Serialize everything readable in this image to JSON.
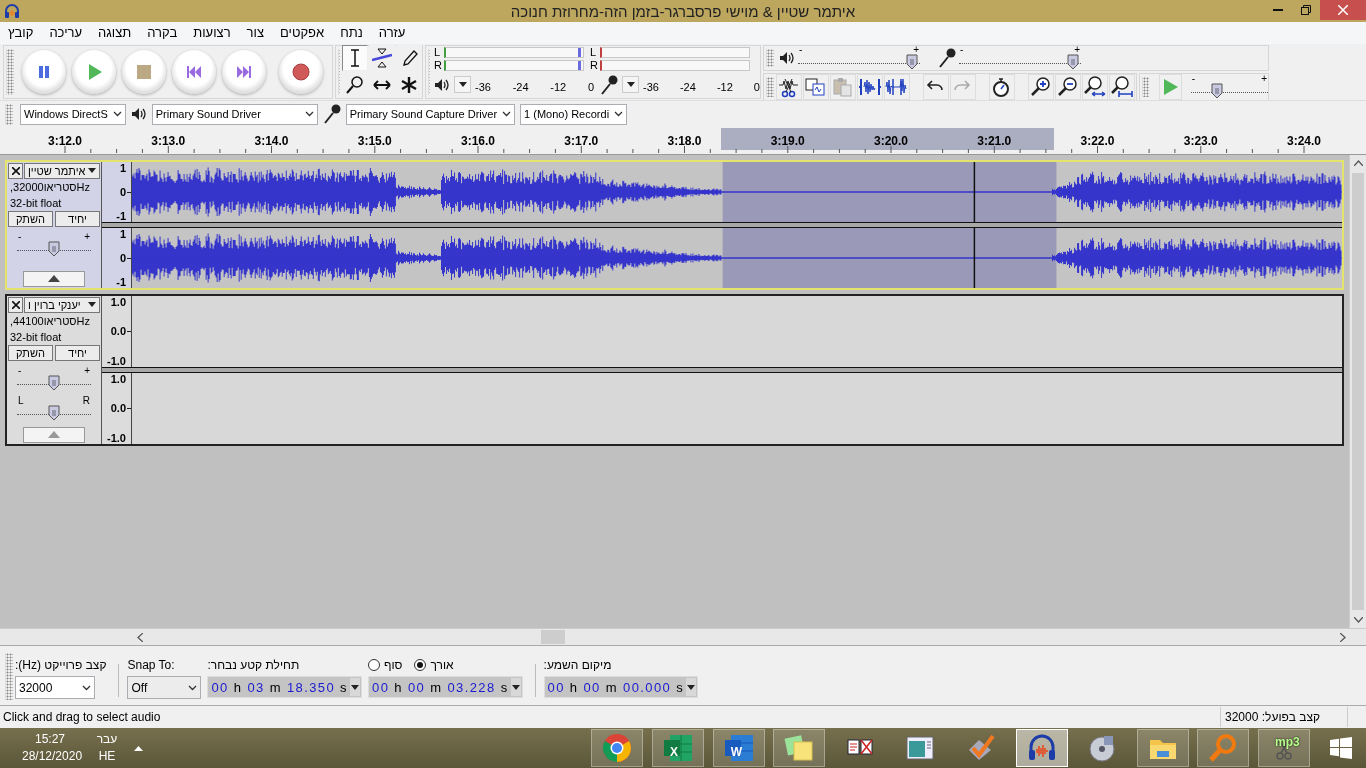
{
  "window": {
    "title": "איתמר שטיין & מוישי פרסברגר-בזמן הזה-מחרוזת חנוכה"
  },
  "menu": [
    "עזרה",
    "נתח",
    "אפקטים",
    "צור",
    "רצועות",
    "בקרה",
    "תצוגה",
    "עריכה",
    "קובץ"
  ],
  "toolbar": {
    "tools": [
      {
        "selected": true
      },
      {
        "selected": false
      },
      {
        "selected": false
      },
      {
        "selected": false
      },
      {
        "selected": false
      },
      {
        "selected": false
      }
    ],
    "meters": [
      {
        "kind": "playback",
        "channels": [
          "L",
          "R"
        ],
        "ticks": [
          "0",
          "-12",
          "-24",
          "-36"
        ]
      },
      {
        "kind": "recording",
        "channels": [
          "L",
          "R"
        ],
        "ticks": [
          "0",
          "-12",
          "-24",
          "-36"
        ]
      }
    ],
    "mixer": [
      {
        "kind": "recording",
        "level": 0.98,
        "min": "-",
        "max": "+"
      },
      {
        "kind": "playback",
        "level": 0.98,
        "min": "-",
        "max": "+"
      }
    ],
    "edit": [
      {
        "disabled": false
      },
      {
        "disabled": false
      },
      {
        "disabled": true
      },
      {
        "disabled": false
      },
      {
        "disabled": false
      },
      {
        "disabled": false
      },
      {
        "disabled": true
      },
      {
        "disabled": false
      },
      {
        "disabled": false
      },
      {
        "disabled": false
      },
      {
        "disabled": false
      },
      {
        "disabled": false
      }
    ],
    "play_at_speed": {
      "level": 0.31,
      "min": "-",
      "max": "+"
    }
  },
  "devices": [
    "1 (Mono) Recordi",
    "Primary Sound Capture Driver",
    "Primary Sound Driver",
    "Windows DirectS"
  ],
  "timeline": {
    "ticks": [
      "3:24.0",
      "3:23.0",
      "3:22.0",
      "3:21.0",
      "3:20.0",
      "3:19.0",
      "3:18.0",
      "3:17.0",
      "3:16.0",
      "3:15.0",
      "3:14.0",
      "3:13.0",
      "3:12.0"
    ]
  },
  "tracks": [
    {
      "name": "איתמר שטיין",
      "info": ",32000סטריאוHz",
      "format": "32-bit float",
      "buttons": [
        "יחיד",
        "השתק"
      ],
      "selected": true,
      "has_audio": true,
      "channels": [
        {
          "scale": [
            "1",
            "0",
            "-1"
          ]
        },
        {
          "scale": [
            "1",
            "0",
            "-1"
          ]
        }
      ],
      "sliders": [
        {
          "level": 0.5,
          "min": "-",
          "max": "+"
        }
      ]
    },
    {
      "name": "יענקי ברוין ו",
      "info": ",44100סטריאוHz",
      "format": "32-bit float",
      "buttons": [
        "יחיד",
        "השתק"
      ],
      "selected": false,
      "has_audio": false,
      "channels": [
        {
          "scale": [
            "1.0",
            "0.0",
            "-1.0"
          ]
        },
        {
          "scale": [
            "1.0",
            "0.0",
            "-1.0"
          ]
        }
      ],
      "sliders": [
        {
          "level": 0.5,
          "min": "-",
          "max": "+"
        },
        {
          "level": 0.5,
          "min": "L",
          "max": "R"
        }
      ]
    }
  ],
  "selection": {
    "rate_label": "קצב פרוייקט (Hz):",
    "rate": "32000",
    "snap_label": "Snap To:",
    "snap": "Off",
    "start_label": "תחילת קטע נבחר:",
    "start": "00 h 03 m 18.350 s",
    "end_options": [
      {
        "label": "אורך",
        "selected": true
      },
      {
        "label": "סוף",
        "selected": false
      }
    ],
    "second_value": "00 h 00 m 03.228 s",
    "audio_label": "מיקום השמע:",
    "audio_position": "00 h 00 m 00.000 s"
  },
  "status": {
    "message": "Click and drag to select audio",
    "rate": "קצב בפועל: 32000"
  },
  "taskbar": {
    "time": "15:27",
    "date": "28/12/2020",
    "language": "עבר",
    "language_code": "HE",
    "apps": [
      {
        "running": true,
        "selected": false
      },
      {
        "running": true,
        "selected": false,
        "label": "X"
      },
      {
        "running": true,
        "selected": false,
        "label": "W"
      },
      {
        "running": true,
        "selected": false
      },
      {
        "running": false,
        "selected": false
      },
      {
        "running": false,
        "selected": false
      },
      {
        "running": false,
        "selected": false
      },
      {
        "running": true,
        "selected": true
      },
      {
        "running": false,
        "selected": false
      },
      {
        "running": true,
        "selected": false
      },
      {
        "running": true,
        "selected": false
      },
      {
        "running": true,
        "selected": false,
        "label": "mp3"
      }
    ]
  }
}
